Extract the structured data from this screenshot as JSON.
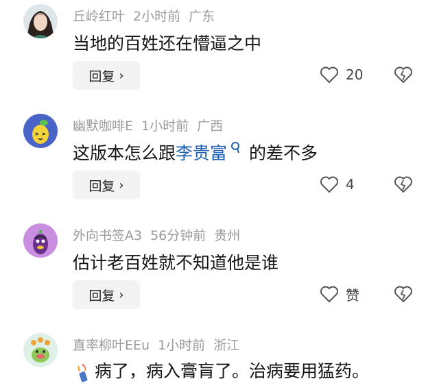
{
  "comments": [
    {
      "username": "丘岭红叶",
      "time": "2小时前",
      "location": "广东",
      "text": "当地的百姓还在懵逼之中",
      "reply_label": "回复",
      "likes": "20"
    },
    {
      "username": "幽默咖啡E",
      "time": "1小时前",
      "location": "广西",
      "text_before": "这版本怎么跟",
      "link_text": "李贵富",
      "text_after": "的差不多",
      "reply_label": "回复",
      "likes": "4"
    },
    {
      "username": "外向书签A3",
      "time": "56分钟前",
      "location": "贵州",
      "text": "估计老百姓就不知道他是谁",
      "reply_label": "回复",
      "likes": "赞"
    },
    {
      "username": "直率柳叶EEu",
      "time": "1小时前",
      "location": "浙江",
      "text": "病了，病入膏肓了。治病要用猛药。"
    }
  ],
  "icons": {
    "like": "heart-icon",
    "dislike": "broken-heart-icon",
    "reply_arrow": "chevron-right-icon",
    "search_mark": "search-icon"
  },
  "colors": {
    "link": "#1f5fb0",
    "meta": "#9a9a9a",
    "reply_bg": "#f3f3f3"
  }
}
